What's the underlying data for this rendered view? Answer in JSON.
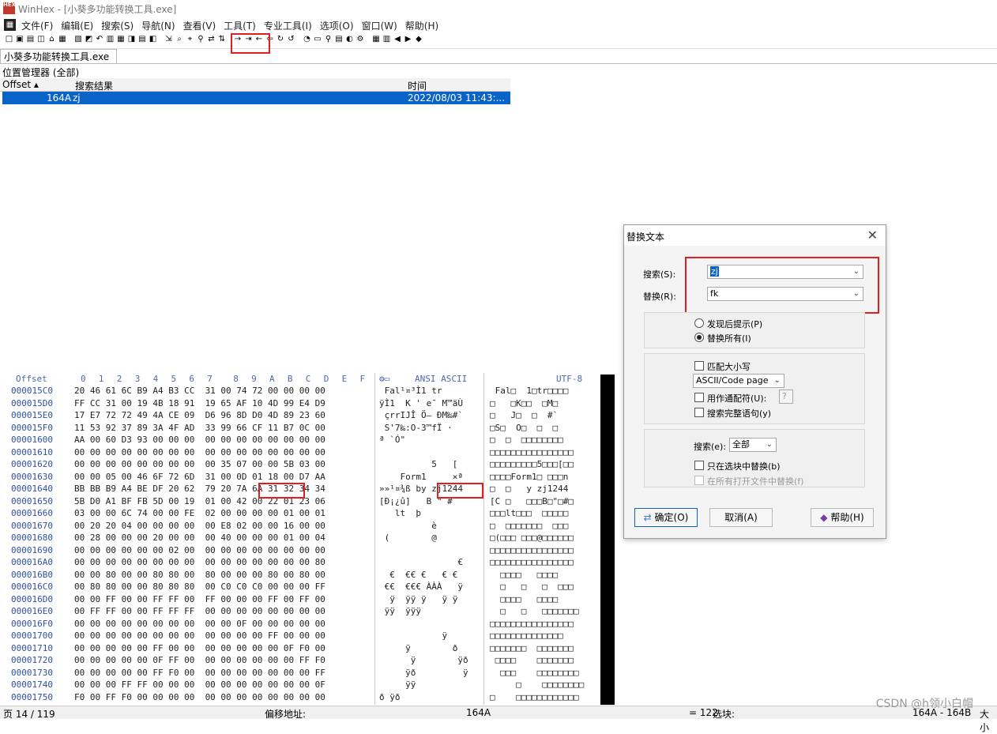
{
  "window": {
    "title": "WinHex - [小葵多功能转换工具.exe]",
    "icon_text": "HEX"
  },
  "menu": [
    "文件(F)",
    "编辑(E)",
    "搜索(S)",
    "导航(N)",
    "查看(V)",
    "工具(T)",
    "专业工具(I)",
    "选项(O)",
    "窗口(W)",
    "帮助(H)"
  ],
  "tab": {
    "label": "小葵多功能转换工具.exe"
  },
  "position_manager": {
    "title": "位置管理器 (全部)",
    "columns": [
      "Offset ▴",
      "搜索结果",
      "时间"
    ],
    "rows": [
      {
        "offset": "164A",
        "result": "zj",
        "time": "2022/08/03  11:43:..."
      }
    ]
  },
  "hex": {
    "header": {
      "offset": "Offset",
      "cols": [
        "0",
        "1",
        "2",
        "3",
        "4",
        "5",
        "6",
        "7",
        "8",
        "9",
        "A",
        "B",
        "C",
        "D",
        "E",
        "F"
      ],
      "ansi": "ANSI ASCII",
      "utf": "UTF-8"
    },
    "rows": [
      {
        "o": "000015C0",
        "h": "20 46 61 6C B9 A4 B3 CC  31 00 74 72 00 00 00 00",
        "a": " Fal¹¤³Ì1 tr",
        "u": " Fal□  1□tr□□□□"
      },
      {
        "o": "000015D0",
        "h": "FF CC 31 00 19 4B 18 91  19 65 AF 10 4D 99 E4 D9",
        "a": "ÿÌ1  K ' e¯ M™äÙ",
        "u": "□   □K□□  □M□"
      },
      {
        "o": "000015E0",
        "h": "17 E7 72 72 49 4A CE 09  D6 96 8D D0 4D 89 23 60",
        "a": " çrrIJÎ Ö– ÐM‰#`",
        "u": "□   J□  □  #`"
      },
      {
        "o": "000015F0",
        "h": "11 53 92 37 89 3A 4F AD  33 99 66 CF 11 B7 0C 00",
        "a": " S'7‰:O-3™fÏ ·",
        "u": "□S□  O□  □  □"
      },
      {
        "o": "00001600",
        "h": "AA 00 60 D3 93 00 00 00  00 00 00 00 00 00 00 00",
        "a": "ª `Ó\"",
        "u": "□  □  □□□□□□□□"
      },
      {
        "o": "00001610",
        "h": "00 00 00 00 00 00 00 00  00 00 00 00 00 00 00 00",
        "a": "",
        "u": "□□□□□□□□□□□□□□□□"
      },
      {
        "o": "00001620",
        "h": "00 00 00 00 00 00 00 00  00 35 07 00 00 5B 03 00",
        "a": "          5   [",
        "u": "□□□□□□□□□5□□□[□□"
      },
      {
        "o": "00001630",
        "h": "00 00 05 00 46 6F 72 6D  31 00 0D 01 18 00 D7 AA",
        "a": "    Form1     ×ª",
        "u": "□□□□Form1□ □□□n"
      },
      {
        "o": "00001640",
        "h": "BB BB B9 A4 BE DF 20 62  79 20 7A 6A 31 32 34 34",
        "a": "»»¹¤¾ß by zj1244",
        "u": "□  □   y zj1244"
      },
      {
        "o": "00001650",
        "h": "5B D0 A1 BF FB 5D 00 19  01 00 42 00 22 01 23 06",
        "a": "[Ð¡¿û]   B \" #",
        "u": "[C □   □□□B□\"□#□"
      },
      {
        "o": "00001660",
        "h": "03 00 00 6C 74 00 00 FE  02 00 00 00 00 01 00 01",
        "a": "   lt  þ",
        "u": "□□□lt□□□  □□□□□"
      },
      {
        "o": "00001670",
        "h": "00 20 20 04 00 00 00 00  00 E8 02 00 00 16 00 00",
        "a": "          è",
        "u": "□  □□□□□□□  □□□"
      },
      {
        "o": "00001680",
        "h": "00 28 00 00 00 20 00 00  00 40 00 00 00 01 00 04",
        "a": " (        @",
        "u": "□(□□□ □□□@□□□□□□"
      },
      {
        "o": "00001690",
        "h": "00 00 00 00 00 00 02 00  00 00 00 00 00 00 00 00",
        "a": "",
        "u": "□□□□□□□□□□□□□□□□"
      },
      {
        "o": "000016A0",
        "h": "00 00 00 00 00 00 00 00  00 00 00 00 00 00 00 80",
        "a": "               €",
        "u": "□□□□□□□□□□□□□□□□"
      },
      {
        "o": "000016B0",
        "h": "00 00 80 00 00 80 80 00  80 00 00 00 80 00 80 00",
        "a": "  €  €€ €   € €",
        "u": "  □□□□   □□□□"
      },
      {
        "o": "000016C0",
        "h": "00 80 80 00 00 80 80 80  00 C0 C0 C0 00 00 00 FF",
        "a": " €€  €€€ ÀÀÀ   ÿ",
        "u": "  □   □   □  □□□"
      },
      {
        "o": "000016D0",
        "h": "00 00 FF 00 00 FF FF 00  FF 00 00 00 FF 00 FF 00",
        "a": "  ÿ  ÿÿ ÿ   ÿ ÿ",
        "u": "  □□□□   □□□□"
      },
      {
        "o": "000016E0",
        "h": "00 FF FF 00 00 FF FF FF  00 00 00 00 00 00 00 00",
        "a": " ÿÿ  ÿÿÿ",
        "u": "  □   □   □□□□□□□"
      },
      {
        "o": "000016F0",
        "h": "00 00 00 00 00 00 00 00  00 00 0F 00 00 00 00 00",
        "a": "",
        "u": "□□□□□□□□□□□□□□□□"
      },
      {
        "o": "00001700",
        "h": "00 00 00 00 00 00 00 00  00 00 00 00 FF 00 00 00",
        "a": "            ÿ",
        "u": "□□□□□□□□□□□□□□"
      },
      {
        "o": "00001710",
        "h": "00 00 00 00 00 FF 00 00  00 00 00 00 00 0F F0 00",
        "a": "     ÿ        ð",
        "u": "□□□□□□□  □□□□□□□"
      },
      {
        "o": "00001720",
        "h": "00 00 00 00 00 0F FF 00  00 00 00 00 00 00 FF F0",
        "a": "      ÿ        ÿð",
        "u": " □□□□    □□□□□□□"
      },
      {
        "o": "00001730",
        "h": "00 00 00 00 00 FF F0 00  00 00 00 00 00 00 00 FF",
        "a": "     ÿð         ÿ",
        "u": "  □□□    □□□□□□□□"
      },
      {
        "o": "00001740",
        "h": "00 00 00 FF FF 00 00 00  00 00 00 00 00 00 00 0F",
        "a": "     ÿÿ",
        "u": "     □    □□□□□□□□"
      },
      {
        "o": "00001750",
        "h": "F0 00 FF F0 00 00 00 00  00 00 00 00 00 00 00 00",
        "a": "ð ÿð",
        "u": "□    □□□□□□□□□□□□"
      }
    ]
  },
  "status": {
    "page": "页 14 / 119",
    "offset_label": "偏移地址:",
    "offset_value": "164A",
    "value": "= 122",
    "block_label": "选块:",
    "block_value": "164A - 164B",
    "size": "大小"
  },
  "watermark": "CSDN @h领小白帽",
  "dialog": {
    "title": "替换文本",
    "search_label": "搜索(S):",
    "search_value": "zj",
    "replace_label": "替换(R):",
    "replace_value": "fk",
    "radio_prompt": "发现后提示(P)",
    "radio_all": "替换所有(I)",
    "match_case": "匹配大小写",
    "codepage": "ASCII/Code page",
    "wildcard": "用作通配符(U):",
    "wildcard_char": "?",
    "whole_word": "搜索完整语句(y)",
    "search_scope_label": "搜索(e):",
    "search_scope_value": "全部",
    "only_block": "只在选块中替换(b)",
    "all_files": "在所有打开文件中替换(f)",
    "ok": "确定(O)",
    "cancel": "取消(A)",
    "help": "帮助(H)"
  }
}
